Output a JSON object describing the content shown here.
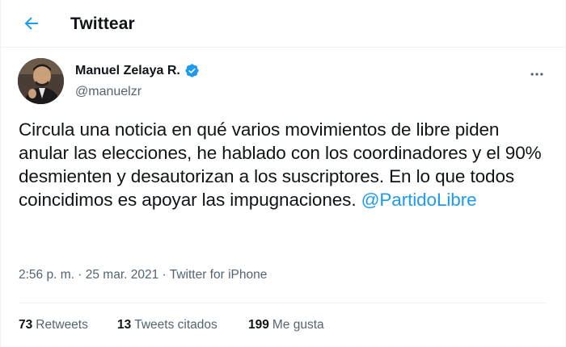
{
  "header": {
    "title": "Twittear"
  },
  "author": {
    "name": "Manuel Zelaya R.",
    "handle": "@manuelzr",
    "verified": true
  },
  "tweet": {
    "text": "Circula una noticia en qué varios movimientos de libre piden anular las elecciones, he hablado con los coordinadores y el 90% desmienten y desautorizan a los suscriptores. En lo que todos coincidimos es apoyar las impugnaciones.",
    "mention": "@PartidoLibre",
    "time": "2:56 p. m.",
    "separator": "·",
    "date": "25 mar. 2021",
    "source": "Twitter for iPhone"
  },
  "stats": [
    {
      "count": "73",
      "label": "Retweets"
    },
    {
      "count": "13",
      "label": "Tweets citados"
    },
    {
      "count": "199",
      "label": "Me gusta"
    }
  ],
  "colors": {
    "accent": "#1d9bf0",
    "text": "#0f1419",
    "secondary": "#536471",
    "border": "#eff3f4"
  },
  "icons": {
    "back": "arrow-left-icon",
    "verified": "verified-badge-icon",
    "more": "more-horizontal-icon"
  }
}
